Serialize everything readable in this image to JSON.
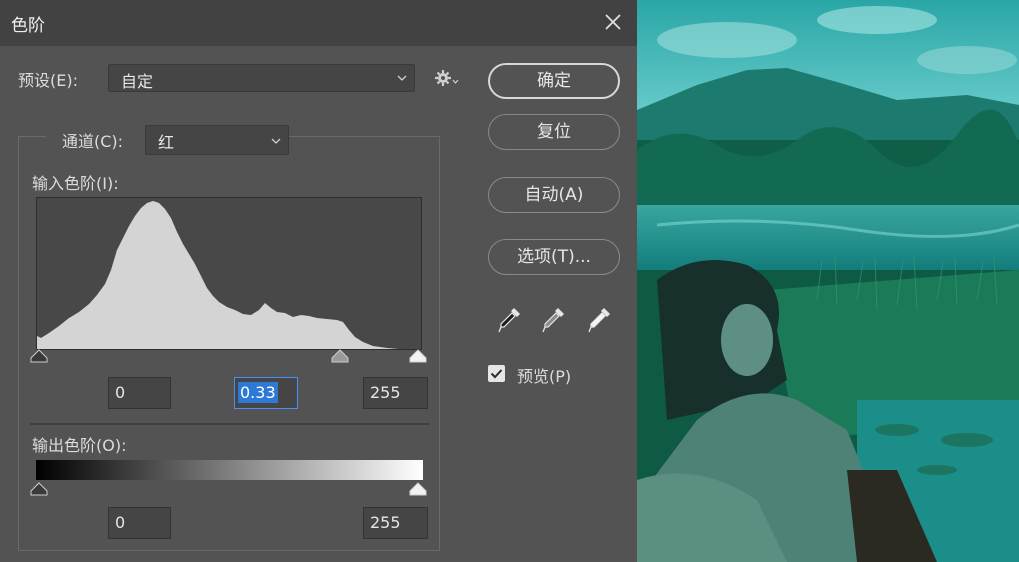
{
  "dialog": {
    "title": "色阶",
    "preset_label": "预设(E):",
    "preset_value": "自定",
    "channel_label": "通道(C):",
    "channel_value": "红",
    "input_levels_label": "输入色阶(I):",
    "input_black": "0",
    "input_gamma": "0.33",
    "input_white": "255",
    "output_levels_label": "输出色阶(O):",
    "output_black": "0",
    "output_white": "255",
    "preview_label": "预览(P)",
    "preview_checked": true
  },
  "buttons": {
    "ok": "确定",
    "reset": "复位",
    "auto": "自动(A)",
    "options": "选项(T)..."
  },
  "icons": [
    "close-icon",
    "gear-icon",
    "chevron-down-icon",
    "black-eyedropper-icon",
    "gray-eyedropper-icon",
    "white-eyedropper-icon",
    "checkbox-icon"
  ],
  "colors": {
    "dialog_bg": "#535353",
    "title_bg": "#424242",
    "histogram_fill": "#d4d4d4",
    "selection": "#2d7ad6"
  }
}
